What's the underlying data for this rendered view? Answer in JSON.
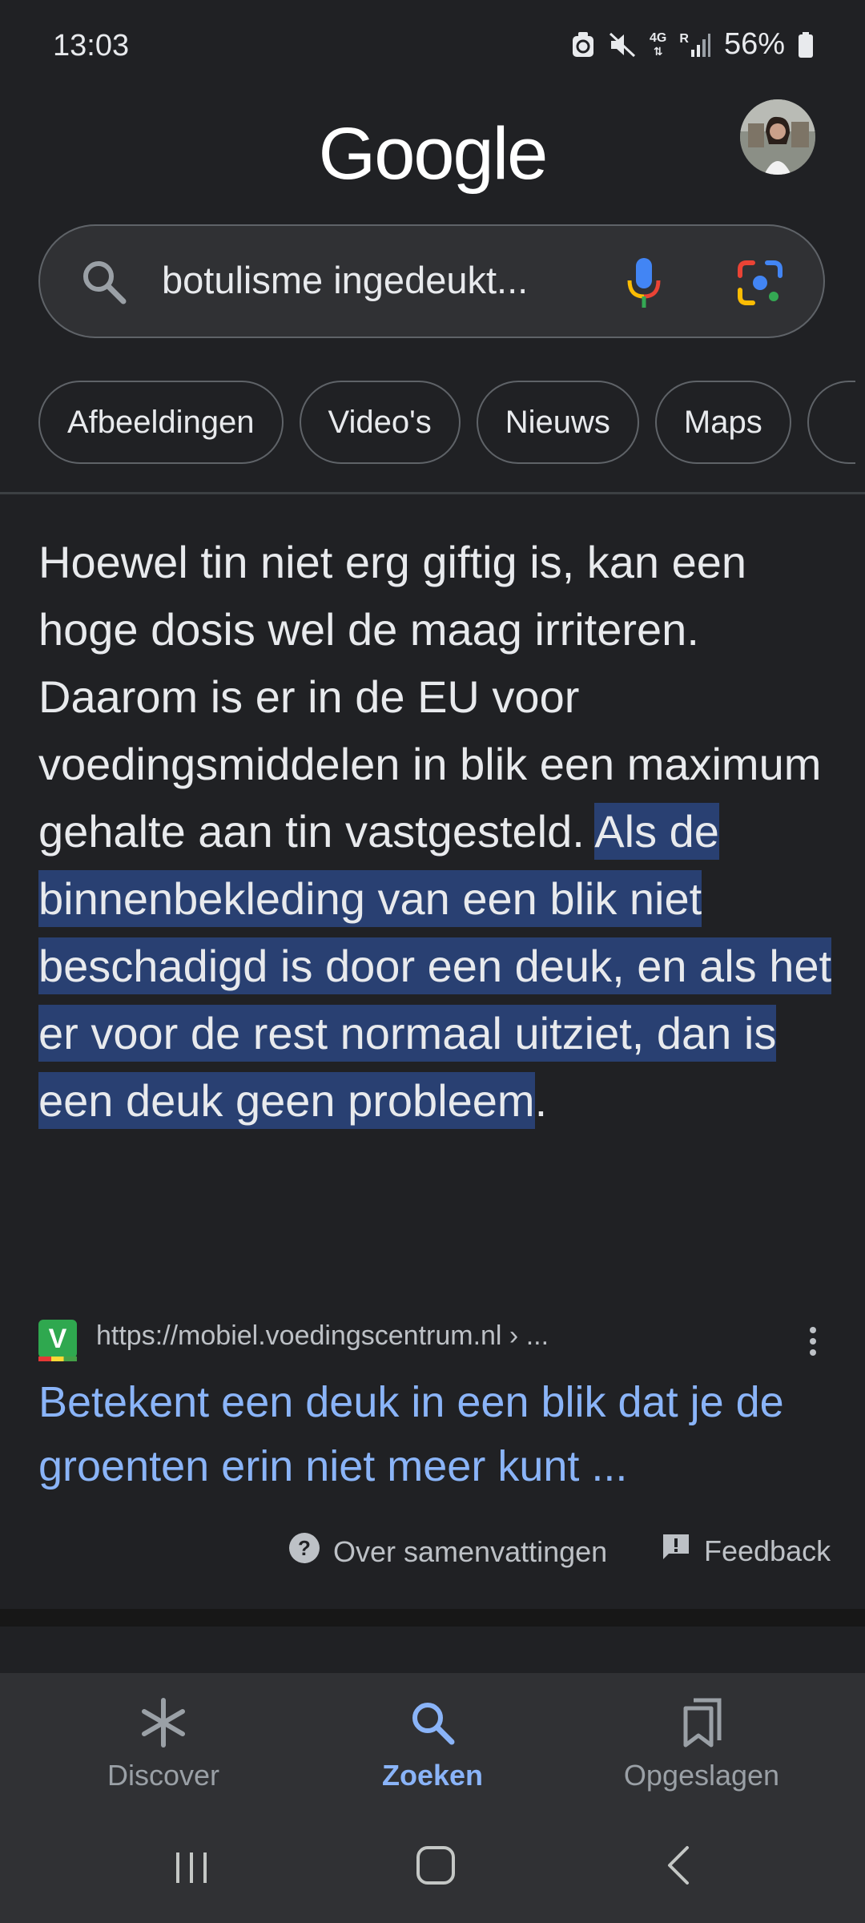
{
  "status_bar": {
    "time": "13:03",
    "network": "4G",
    "roaming": "R",
    "battery": "56%"
  },
  "header": {
    "logo_text": "Google"
  },
  "search": {
    "query": "botulisme ingedeukt..."
  },
  "chips": [
    {
      "label": "Afbeeldingen"
    },
    {
      "label": "Video's"
    },
    {
      "label": "Nieuws"
    },
    {
      "label": "Maps"
    }
  ],
  "summary": {
    "plain": "Hoewel tin niet erg giftig is, kan een hoge dosis wel de maag irriteren. Daarom is er in de EU voor voedingsmiddelen in blik een maximum gehalte aan tin vastgesteld. ",
    "highlighted": "Als de binnenbekleding van een blik niet beschadigd is door een deuk, en als het er voor de rest normaal uitziet, dan is een deuk geen probleem",
    "end": "."
  },
  "source": {
    "favicon_letter": "V",
    "url": "https://mobiel.voedingscentrum.nl › ...",
    "title": "Betekent een deuk in een blik dat je de groenten erin niet meer kunt ..."
  },
  "actions": {
    "about": "Over samenvattingen",
    "feedback": "Feedback"
  },
  "bottom_nav": {
    "discover": "Discover",
    "search": "Zoeken",
    "saved": "Opgeslagen"
  },
  "colors": {
    "background": "#202124",
    "highlight": "#294072",
    "link": "#8ab4f8",
    "active_nav": "#8ab4f8"
  }
}
